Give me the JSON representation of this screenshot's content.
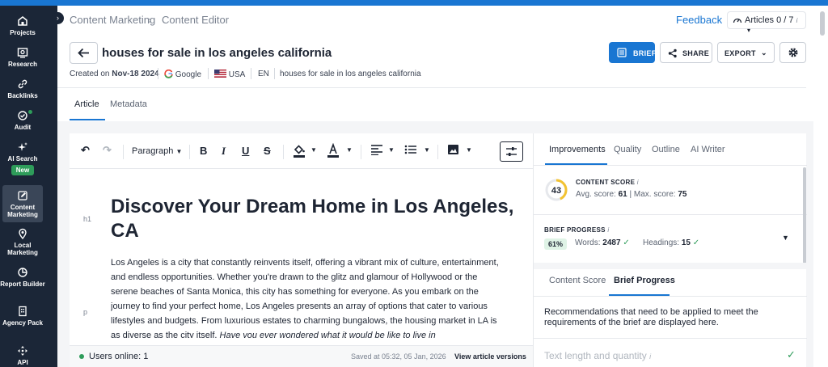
{
  "sidebar": {
    "items": [
      {
        "label": "Projects",
        "icon": "home-icon"
      },
      {
        "label": "Research",
        "icon": "research-icon"
      },
      {
        "label": "Backlinks",
        "icon": "link-icon"
      },
      {
        "label": "Audit",
        "icon": "audit-icon"
      },
      {
        "label": "AI Search",
        "icon": "sparkle-icon",
        "badge": "New"
      },
      {
        "label": "Content Marketing",
        "icon": "edit-icon"
      },
      {
        "label": "Local Marketing",
        "icon": "map-pin-icon"
      },
      {
        "label": "Report Builder",
        "icon": "report-icon"
      },
      {
        "label": "Agency Pack",
        "icon": "building-icon"
      },
      {
        "label": "API",
        "icon": "api-icon"
      }
    ],
    "active": "Content Marketing"
  },
  "header": {
    "breadcrumb": [
      "Content Marketing",
      "Content Editor"
    ],
    "feedback": "Feedback",
    "articles_label": "Articles",
    "articles_count": "0 / 7"
  },
  "document": {
    "title": "houses for sale in los angeles california",
    "created_prefix": "Created on",
    "created_date": "Nov-18 2024",
    "engine": "Google",
    "country": "USA",
    "language": "EN",
    "keyword": "houses for sale in los angeles california"
  },
  "actions": {
    "brief": "BRIEF",
    "share": "SHARE",
    "export": "EXPORT"
  },
  "tabs": [
    "Article",
    "Metadata"
  ],
  "editor": {
    "block_style": "Paragraph",
    "h1_tag": "h1",
    "p_tag": "p",
    "heading": "Discover Your Dream Home in Los Angeles, CA",
    "paragraph": "Los Angeles is a city that constantly reinvents itself, offering a vibrant mix of culture, entertainment, and endless opportunities. Whether you're drawn to the glitz and glamour of Hollywood or the serene beaches of Santa Monica, this city has something for everyone. As you embark on the journey to find your perfect home, Los Angeles presents an array of options that cater to various lifestyles and budgets. From luxurious estates to charming bungalows, the housing market in LA is as diverse as the city itself.",
    "paragraph_italic": "Have you ever wondered what it would be like to live in",
    "online": "Users online: 1",
    "saved": "Saved at 05:32, 05 Jan, 2026",
    "versions": "View article versions"
  },
  "panel": {
    "tabs": [
      "Improvements",
      "Quality",
      "Outline",
      "AI Writer"
    ],
    "content_score_label": "CONTENT SCORE",
    "content_score": "43",
    "avg_label": "Avg. score:",
    "avg_value": "61",
    "max_label": "Max. score:",
    "max_value": "75",
    "brief_progress_label": "BRIEF PROGRESS",
    "brief_pct": "61%",
    "words_label": "Words:",
    "words_value": "2487",
    "headings_label": "Headings:",
    "headings_value": "15",
    "sub_tabs": [
      "Content Score",
      "Brief Progress"
    ],
    "recommendation": "Recommendations that need to be applied to meet the requirements of the brief are displayed here.",
    "section": "Text length and quantity"
  },
  "colors": {
    "accent": "#1976d2",
    "sidebar": "#1b2637",
    "success": "#2e9c5a",
    "score_ring": "#f2c230"
  }
}
